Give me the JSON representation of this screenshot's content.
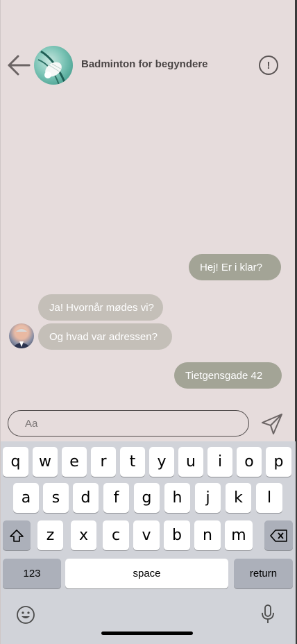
{
  "header": {
    "back_icon": "arrow-left-icon",
    "title": "Badminton for begyndere",
    "info_icon": "exclamation-circle-icon",
    "info_glyph": "!"
  },
  "messages": [
    {
      "from": "me",
      "text": "Hej! Er i klar?"
    },
    {
      "from": "other",
      "text": "Ja! Hvornår mødes vi?"
    },
    {
      "from": "other",
      "text": "Og hvad var adressen?"
    },
    {
      "from": "me",
      "text": "Tietgensgade 42"
    }
  ],
  "composer": {
    "placeholder": "Aa",
    "value": "",
    "send_icon": "paper-plane-icon"
  },
  "keyboard": {
    "row1": [
      "q",
      "w",
      "e",
      "r",
      "t",
      "y",
      "u",
      "i",
      "o",
      "p"
    ],
    "row2": [
      "a",
      "s",
      "d",
      "f",
      "g",
      "h",
      "j",
      "k",
      "l"
    ],
    "row3": [
      "z",
      "x",
      "c",
      "v",
      "b",
      "n",
      "m"
    ],
    "shift_icon": "shift-icon",
    "delete_icon": "backspace-icon",
    "numbers_label": "123",
    "space_label": "space",
    "return_label": "return",
    "emoji_icon": "emoji-icon",
    "mic_icon": "microphone-icon"
  },
  "colors": {
    "background": "#e6dcdc",
    "sent_bubble": "#a3a496",
    "received_bubble": "#c4bfb8",
    "keyboard": "#d1d3d9"
  }
}
